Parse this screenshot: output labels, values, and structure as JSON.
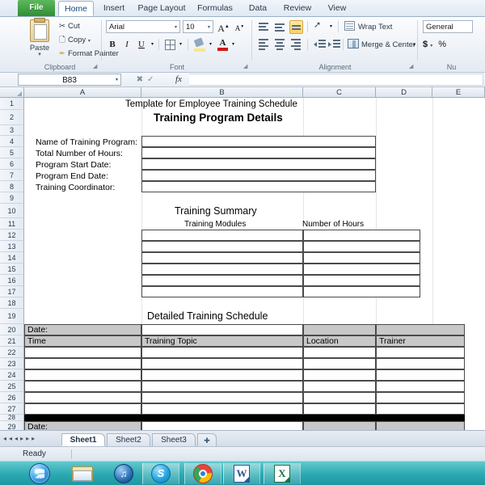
{
  "ribbon": {
    "tabs": [
      {
        "label": "File",
        "active": false,
        "kind": "file"
      },
      {
        "label": "Home",
        "active": true,
        "kind": "normal"
      },
      {
        "label": "Insert",
        "active": false,
        "kind": "normal"
      },
      {
        "label": "Page Layout",
        "active": false,
        "kind": "normal"
      },
      {
        "label": "Formulas",
        "active": false,
        "kind": "normal"
      },
      {
        "label": "Data",
        "active": false,
        "kind": "normal"
      },
      {
        "label": "Review",
        "active": false,
        "kind": "normal"
      },
      {
        "label": "View",
        "active": false,
        "kind": "normal"
      }
    ],
    "clipboard": {
      "group_label": "Clipboard",
      "paste": "Paste",
      "cut": "Cut",
      "copy": "Copy",
      "format_painter": "Format Painter"
    },
    "font": {
      "group_label": "Font",
      "font_name": "Arial",
      "font_size": "10",
      "grow_font": "A",
      "shrink_font": "A",
      "bold": "B",
      "italic": "I",
      "underline": "U"
    },
    "alignment": {
      "group_label": "Alignment",
      "wrap_text": "Wrap Text",
      "merge_center": "Merge & Center"
    },
    "number": {
      "group_label": "Nu",
      "format": "General",
      "currency": "$",
      "percent": "%"
    }
  },
  "formula_bar": {
    "name_box": "B83",
    "formula": ""
  },
  "grid": {
    "columns": [
      "A",
      "B",
      "C",
      "D",
      "E"
    ],
    "rows": [
      "1",
      "2",
      "3",
      "4",
      "5",
      "6",
      "7",
      "8",
      "9",
      "10",
      "11",
      "12",
      "13",
      "14",
      "15",
      "16",
      "17",
      "18",
      "19",
      "20",
      "21",
      "22",
      "23",
      "24",
      "25",
      "26",
      "27",
      "28",
      "29"
    ]
  },
  "sheet": {
    "doc_title": "Template for Employee Training Schedule",
    "section1": {
      "heading": "Training Program Details",
      "fields": [
        "Name of Training Program:",
        "Total Number of Hours:",
        "Program Start Date:",
        "Program End Date:",
        "Training Coordinator:"
      ]
    },
    "section2": {
      "heading": "Training Summary",
      "col_modules": "Training Modules",
      "col_hours": "Number of Hours"
    },
    "section3": {
      "heading": "Detailed Training Schedule",
      "date_label_1": "Date:",
      "date_label_2": "Date:",
      "headers": [
        "Time",
        "Training Topic",
        "Location",
        "Trainer"
      ]
    }
  },
  "sheet_tabs": {
    "nav_first": "◂◂",
    "nav_prev": "◂",
    "nav_next": "▸",
    "nav_last": "▸▸",
    "tabs": [
      {
        "label": "Sheet1",
        "active": true
      },
      {
        "label": "Sheet2",
        "active": false
      },
      {
        "label": "Sheet3",
        "active": false
      }
    ],
    "new_sheet": "➕"
  },
  "status_bar": {
    "state": "Ready"
  },
  "taskbar": {
    "items": [
      {
        "name": "start-orb",
        "label": "Start"
      },
      {
        "name": "file-explorer",
        "label": "Windows Explorer"
      },
      {
        "name": "itunes",
        "label": "iTunes"
      },
      {
        "name": "skype",
        "label": "Skype"
      },
      {
        "name": "chrome",
        "label": "Google Chrome"
      },
      {
        "name": "word",
        "label": "Microsoft Word"
      },
      {
        "name": "excel",
        "label": "Microsoft Excel"
      }
    ]
  },
  "colors": {
    "file_tab_green": "#2f8f34",
    "taskbar_teal": "#2aa9b3",
    "header_shade": "#c8c8c8",
    "border": "#4a4a4a"
  }
}
